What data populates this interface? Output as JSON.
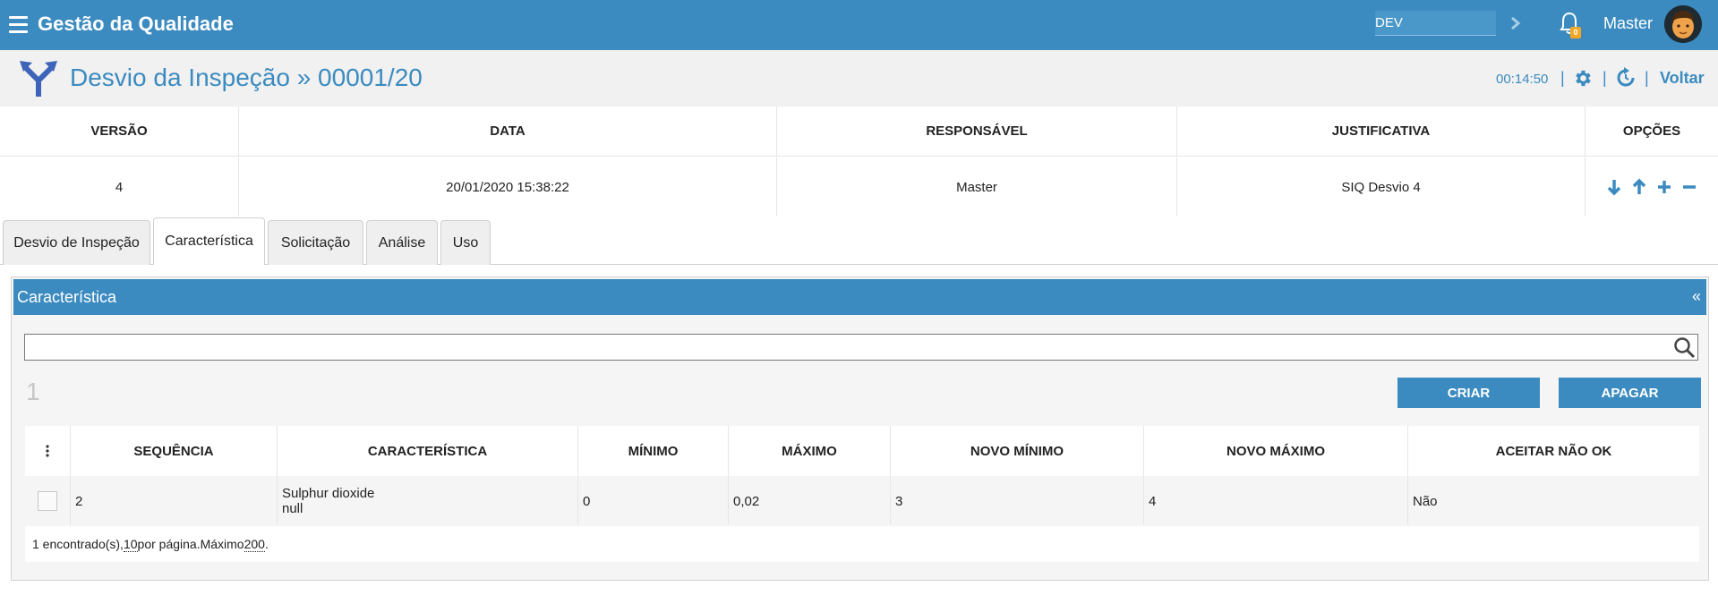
{
  "topbar": {
    "app_title": "Gestão da Qualidade",
    "env_value": "DEV",
    "notification_count": "0",
    "user_name": "Master"
  },
  "header": {
    "title": "Desvio da Inspeção » 00001/20",
    "timer": "00:14:50",
    "separator": "|",
    "back_label": "Voltar"
  },
  "versions": {
    "columns": [
      "VERSÃO",
      "DATA",
      "RESPONSÁVEL",
      "JUSTIFICATIVA",
      "OPÇÕES"
    ],
    "rows": [
      {
        "version": "4",
        "date": "20/01/2020 15:38:22",
        "responsible": "Master",
        "justification": "SIQ Desvio 4"
      }
    ]
  },
  "tabs": [
    {
      "label": "Desvio de Inspeção"
    },
    {
      "label": "Característica",
      "active": true
    },
    {
      "label": "Solicitação"
    },
    {
      "label": "Análise"
    },
    {
      "label": "Uso"
    }
  ],
  "panel": {
    "title": "Característica",
    "collapse_glyph": "«",
    "search_value": "",
    "count": "1",
    "create_label": "CRIAR",
    "delete_label": "APAGAR",
    "columns": [
      "SEQUÊNCIA",
      "CARACTERÍSTICA",
      "MÍNIMO",
      "MÁXIMO",
      "NOVO MÍNIMO",
      "NOVO MÁXIMO",
      "ACEITAR NÃO OK"
    ],
    "rows": [
      {
        "sequence": "2",
        "characteristic_line1": "Sulphur dioxide",
        "characteristic_line2": "null",
        "min": "0",
        "max": "0,02",
        "new_min": "3",
        "new_max": "4",
        "accept_not_ok": "Não"
      }
    ],
    "footer": {
      "found_text": "1 encontrado(s), ",
      "per_page": "10",
      "per_page_text": " por página.Máximo ",
      "max": "200",
      "end": "."
    }
  },
  "colors": {
    "primary": "#3b8bc0",
    "background": "#f1f1f1"
  }
}
